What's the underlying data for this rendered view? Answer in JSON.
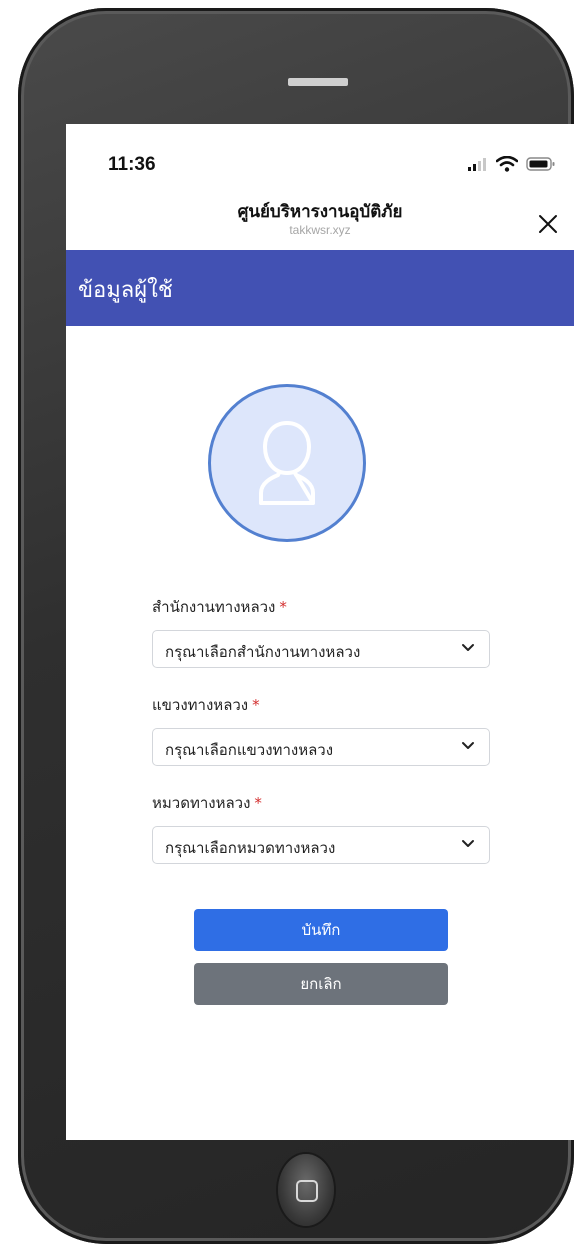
{
  "status_bar": {
    "time": "11:36",
    "icons": [
      "cellular-signal-icon",
      "wifi-icon",
      "battery-icon"
    ]
  },
  "browser": {
    "title": "ศูนย์บริหารงานอุบัติภัย",
    "url": "takkwsr.xyz",
    "close_icon": "close-icon"
  },
  "header": {
    "title": "ข้อมูลผู้ใช้"
  },
  "avatar": {
    "icon": "user-icon"
  },
  "form": {
    "fields": [
      {
        "label": "สำนักงานทางหลวง",
        "required": "*",
        "value": "กรุณาเลือกสำนักงานทางหลวง"
      },
      {
        "label": "แขวงทางหลวง",
        "required": "*",
        "value": "กรุณาเลือกแขวงทางหลวง"
      },
      {
        "label": "หมวดทางหลวง",
        "required": "*",
        "value": "กรุณาเลือกหมวดทางหลวง"
      }
    ],
    "save_label": "บันทึก",
    "cancel_label": "ยกเลิก"
  },
  "colors": {
    "header_bg": "#4251b3",
    "primary": "#2f6ee5",
    "secondary": "#6d737b",
    "required": "#d32f2f",
    "avatar_bg": "#dde6fb",
    "avatar_border": "#5380d0"
  }
}
